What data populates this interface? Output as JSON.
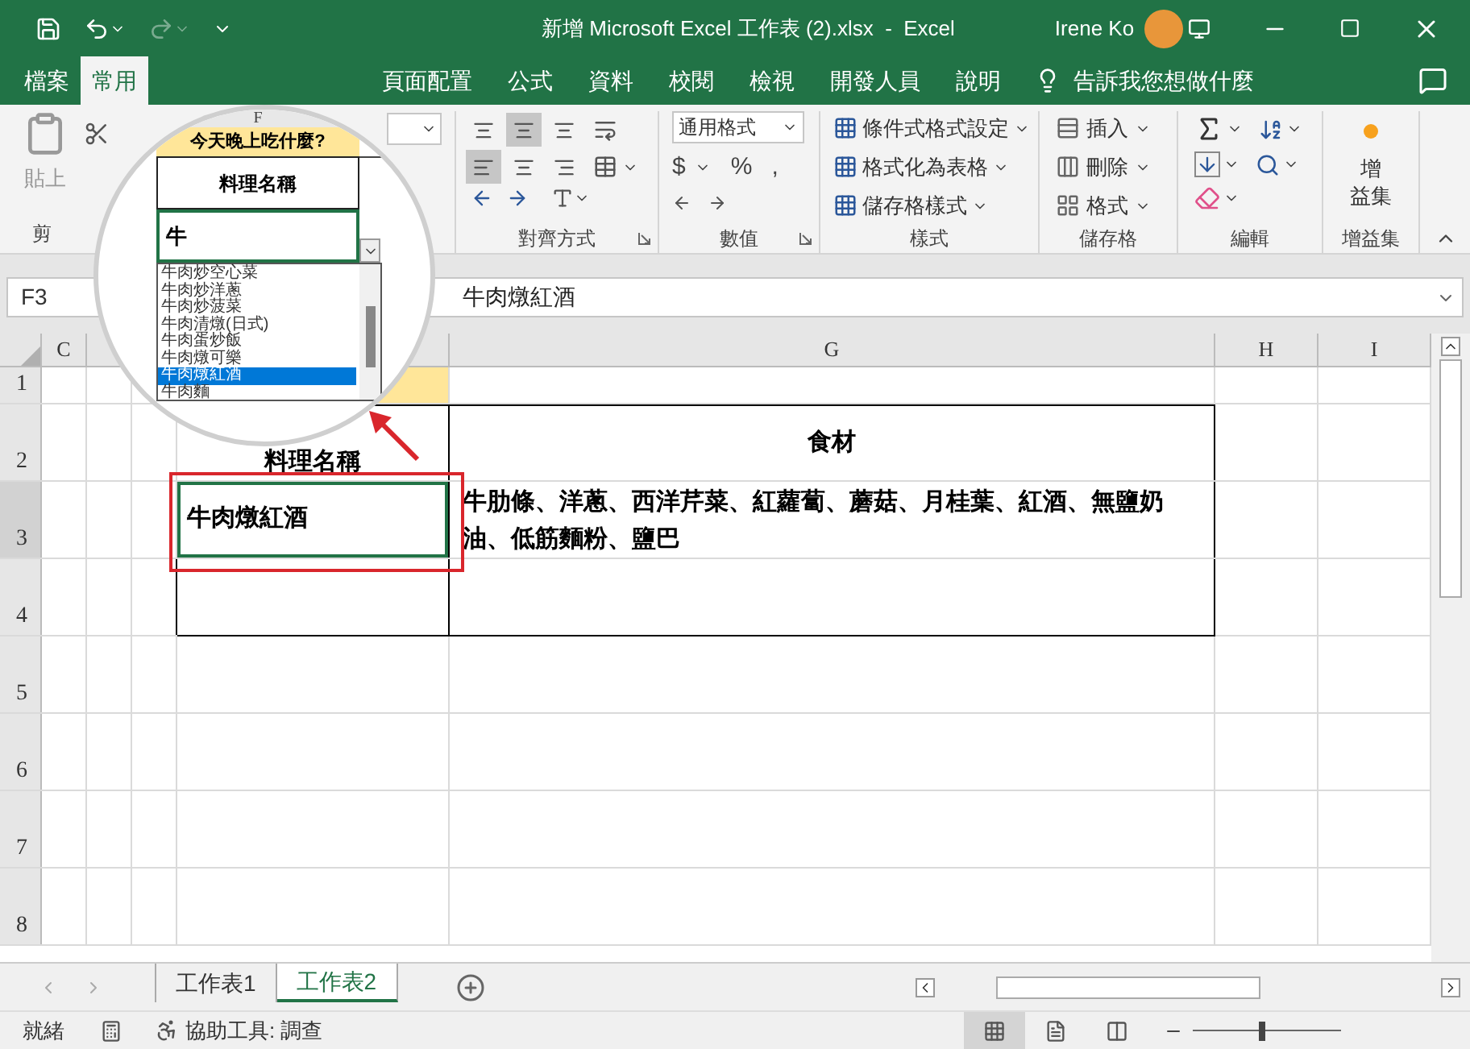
{
  "title_bar": {
    "title": "新增 Microsoft Excel 工作表 (2).xlsx  -  Excel",
    "user": "Irene Ko"
  },
  "ribbon_tabs": [
    {
      "label": "檔案",
      "selected": false
    },
    {
      "label": "常用",
      "selected": true
    },
    {
      "label": "頁面配置",
      "selected": false
    },
    {
      "label": "公式",
      "selected": false
    },
    {
      "label": "資料",
      "selected": false
    },
    {
      "label": "校閱",
      "selected": false
    },
    {
      "label": "檢視",
      "selected": false
    },
    {
      "label": "開發人員",
      "selected": false
    },
    {
      "label": "說明",
      "selected": false
    }
  ],
  "tell_me": "告訴我您想做什麼",
  "ribbon": {
    "clipboard": {
      "paste": "貼上",
      "label": "剪"
    },
    "alignment": {
      "label": "對齊方式",
      "vertical": [
        {
          "selected": false
        },
        {
          "selected": true
        },
        {
          "selected": false
        }
      ],
      "horizontal": [
        {
          "selected": true
        },
        {
          "selected": false
        },
        {
          "selected": false
        }
      ]
    },
    "number": {
      "format": "通用格式",
      "symbols": [
        "$",
        "%",
        ","
      ],
      "label": "數值"
    },
    "styles": {
      "items": [
        "條件式格式設定",
        "格式化為表格",
        "儲存格樣式"
      ],
      "label": "樣式"
    },
    "cells": {
      "items": [
        "插入",
        "刪除",
        "格式"
      ],
      "label": "儲存格"
    },
    "editing": {
      "label": "編輯"
    },
    "addins": {
      "button_lines": [
        "增",
        "益集"
      ],
      "label": "增益集"
    }
  },
  "formula_bar": {
    "name_box": "F3",
    "content": "牛肉燉紅酒"
  },
  "sheet": {
    "column_headers": [
      "C",
      "G",
      "H",
      "I"
    ],
    "row_headers": [
      "1",
      "2",
      "3",
      "4",
      "5",
      "6",
      "7",
      "8"
    ],
    "header_cells": [
      "料理名稱",
      "食材"
    ],
    "dish": "牛肉燉紅酒",
    "ingredients": "牛肋條、洋蔥、西洋芹菜、紅蘿蔔、蘑菇、月桂葉、紅酒、無鹽奶油、低筋麵粉、鹽巴"
  },
  "magnifier": {
    "column": "F",
    "title": "今天晚上吃什麼?",
    "header": "料理名稱",
    "input": "牛",
    "options": [
      {
        "label": "牛肉炒空心菜",
        "selected": false
      },
      {
        "label": "牛肉炒洋蔥",
        "selected": false
      },
      {
        "label": "牛肉炒菠菜",
        "selected": false
      },
      {
        "label": "牛肉清燉(日式)",
        "selected": false
      },
      {
        "label": "牛肉蛋炒飯",
        "selected": false
      },
      {
        "label": "牛肉燉可樂",
        "selected": false
      },
      {
        "label": "牛肉燉紅酒",
        "selected": true
      },
      {
        "label": "牛肉麵",
        "selected": false
      }
    ]
  },
  "sheet_tabs": [
    {
      "label": "工作表1",
      "selected": false
    },
    {
      "label": "工作表2",
      "selected": true
    }
  ],
  "status_bar": {
    "ready": "就緒",
    "accessibility": "協助工具: 調查",
    "views": [
      {
        "selected": true
      },
      {
        "selected": false
      },
      {
        "selected": false
      }
    ],
    "zoom": {
      "level": 0.45
    }
  }
}
